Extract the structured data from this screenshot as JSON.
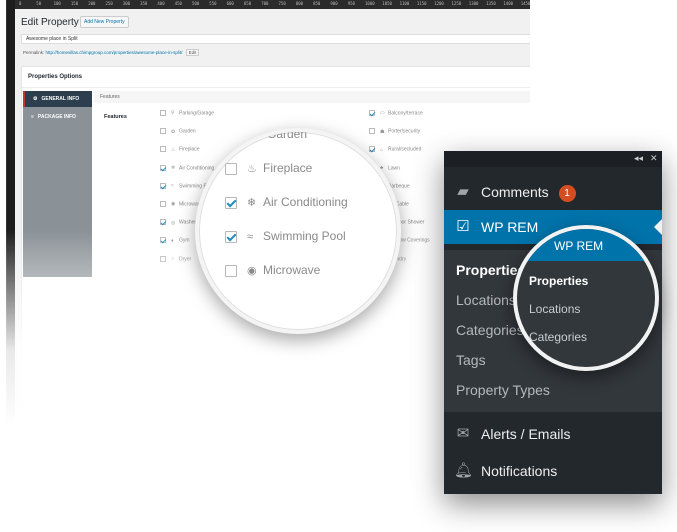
{
  "editor": {
    "page_title": "Edit Property",
    "add_new_label": "Add New Property",
    "property_title": "Awesome place in Split",
    "permalink_label": "Permalink:",
    "permalink_url": "http://homevillas.chimpgroup.com/properties/awesome-place-in-split/",
    "edit_label": "Edit",
    "ruler_ticks": [
      "0",
      "50",
      "100",
      "150",
      "200",
      "250",
      "300",
      "350",
      "400",
      "450",
      "500",
      "550",
      "600",
      "650",
      "700",
      "750",
      "800",
      "850",
      "900",
      "950",
      "1000",
      "1050",
      "1100",
      "1150",
      "1200",
      "1250",
      "1300",
      "1350",
      "1400",
      "1450"
    ],
    "box_title": "Properties Options",
    "tabs": [
      {
        "label": "GENERAL INFO",
        "icon": "gear-icon",
        "active": true
      },
      {
        "label": "PACKAGE INFO",
        "icon": "list-icon",
        "active": false
      }
    ],
    "features_header": "Features",
    "features_label": "Features",
    "features_left": [
      {
        "label": "Parking/Garage",
        "checked": false,
        "icon": "map-pin-icon"
      },
      {
        "label": "Garden",
        "checked": false,
        "icon": "tree-icon"
      },
      {
        "label": "Fireplace",
        "checked": false,
        "icon": "flame-icon"
      },
      {
        "label": "Air Conditioning",
        "checked": true,
        "icon": "ac-icon"
      },
      {
        "label": "Swimming Pool",
        "checked": true,
        "icon": "pool-icon"
      },
      {
        "label": "Microwave",
        "checked": false,
        "icon": "microwave-icon"
      },
      {
        "label": "Washer",
        "checked": true,
        "icon": "washer-icon"
      },
      {
        "label": "Gym",
        "checked": true,
        "icon": "gym-icon"
      },
      {
        "label": "Dryer",
        "checked": false,
        "icon": "dryer-icon"
      }
    ],
    "features_right": [
      {
        "label": "Balcony/terrace",
        "checked": true,
        "icon": "balcony-icon"
      },
      {
        "label": "Porter/security",
        "checked": false,
        "icon": "porter-icon"
      },
      {
        "label": "Rural/secluded",
        "checked": true,
        "icon": "rural-icon"
      },
      {
        "label": "Lawn",
        "checked": false,
        "icon": "lawn-icon"
      },
      {
        "label": "Barbeque",
        "checked": true,
        "icon": "barbeque-icon"
      },
      {
        "label": "TV Cable",
        "checked": false,
        "icon": "tv-icon"
      },
      {
        "label": "Outdoor Shower",
        "checked": false,
        "icon": "shower-icon"
      },
      {
        "label": "Window Coverings",
        "checked": true,
        "icon": "window-icon"
      },
      {
        "label": "Laundry",
        "checked": false,
        "icon": "laundry-icon"
      }
    ]
  },
  "magnifier_features": {
    "items": [
      {
        "label": "Garden",
        "checked": false,
        "icon": "tree-icon",
        "show_checkbox": false
      },
      {
        "label": "Fireplace",
        "checked": false,
        "icon": "flame-icon",
        "show_checkbox": true
      },
      {
        "label": "Air Conditioning",
        "checked": true,
        "icon": "ac-icon",
        "show_checkbox": true
      },
      {
        "label": "Swimming Pool",
        "checked": true,
        "icon": "pool-icon",
        "show_checkbox": true
      },
      {
        "label": "Microwave",
        "checked": false,
        "icon": "microwave-icon",
        "show_checkbox": true
      }
    ]
  },
  "admin_menu": {
    "comments_label": "Comments",
    "comments_count": "1",
    "plugin_label": "WP REM",
    "submenu": [
      "Properties",
      "Locations",
      "Categories",
      "Tags",
      "Property Types"
    ],
    "alerts_label": "Alerts / Emails",
    "notifications_label": "Notifications"
  },
  "magnifier_menu": {
    "header": "WP REM",
    "items": [
      "Properties",
      "Locations",
      "Categories"
    ]
  },
  "colors": {
    "accent_blue": "#0073aa",
    "menu_dark": "#23282d",
    "submenu_dark": "#32373c",
    "badge_orange": "#d54e21",
    "check_blue": "#1e8cbe"
  }
}
